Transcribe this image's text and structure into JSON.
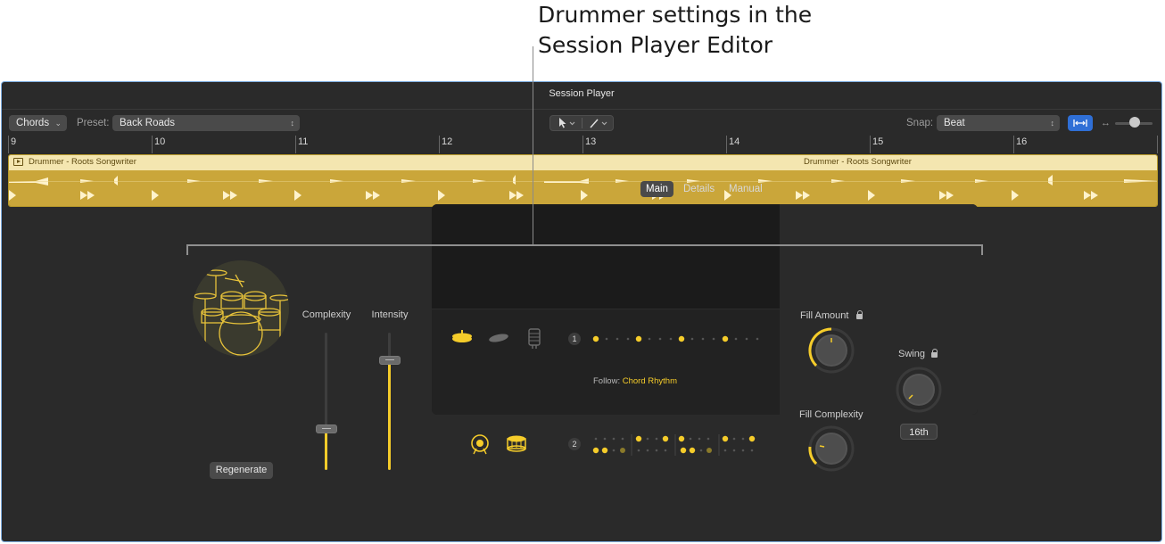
{
  "callout": {
    "line1": "Drummer settings in the",
    "line2": "Session Player Editor"
  },
  "window": {
    "title": "Session Player"
  },
  "toolbar": {
    "chords_label": "Chords",
    "preset_label": "Preset:",
    "preset_value": "Back Roads",
    "snap_label": "Snap:",
    "snap_value": "Beat"
  },
  "ruler": {
    "bars": [
      "9",
      "10",
      "11",
      "12",
      "13",
      "14",
      "15",
      "16"
    ]
  },
  "region": {
    "name_left": "Drummer - Roots Songwriter",
    "name_right": "Drummer - Roots Songwriter"
  },
  "tabs": [
    "Main",
    "Details",
    "Manual"
  ],
  "active_tab": "Main",
  "drummer": {
    "type": "Acoustic Drummer",
    "style": "Roots Songwriter",
    "regenerate_label": "Regenerate"
  },
  "sliders": {
    "complexity_label": "Complexity",
    "intensity_label": "Intensity",
    "complexity_level": 0.3,
    "intensity_level": 0.8
  },
  "lanes": {
    "top_number": "1",
    "bottom_number": "2",
    "follow_label": "Follow:",
    "follow_value": "Chord Rhythm"
  },
  "knobs": {
    "fill_amount_label": "Fill Amount",
    "fill_complexity_label": "Fill Complexity",
    "swing_label": "Swing",
    "swing_value": "16th"
  },
  "colors": {
    "accent": "#f5cc2a",
    "selection": "#2f6fd6",
    "region": "#caa63a"
  }
}
